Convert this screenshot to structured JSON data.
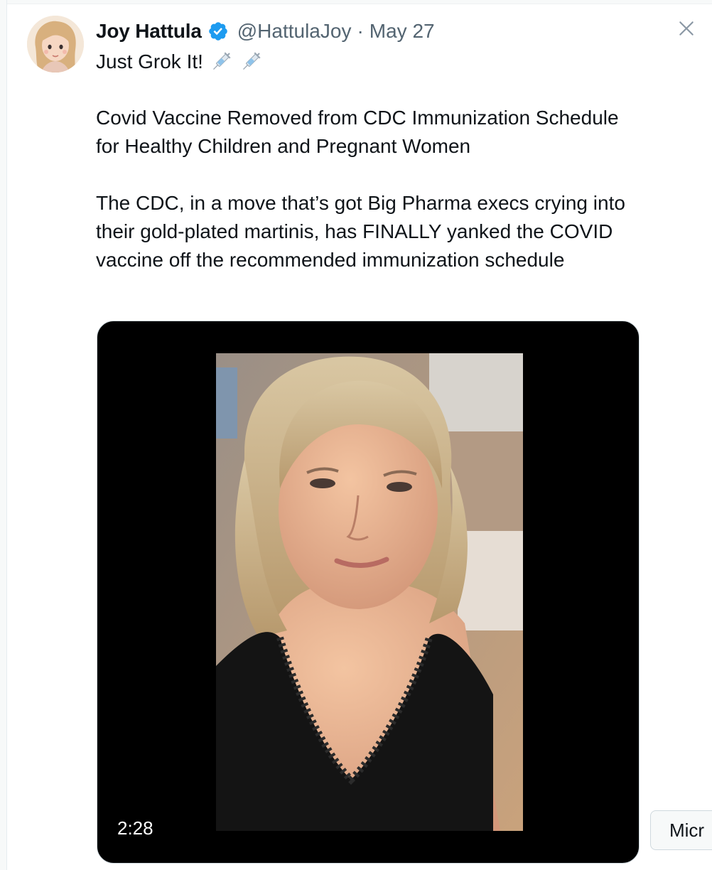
{
  "author": {
    "display_name": "Joy Hattula",
    "handle": "@HattulaJoy",
    "separator": "·",
    "date": "May 27",
    "verified_color": "#1d9bf0"
  },
  "tweet": {
    "line1": "Just Grok It!",
    "line1_emoji": [
      "syringe-icon",
      "syringe-icon"
    ],
    "headline": "Covid Vaccine Removed from CDC Immunization Schedule for Healthy Children and Pregnant Women",
    "body": "The CDC, in a move that’s got Big Pharma execs crying into their gold-plated martinis, has FINALLY yanked the COVID vaccine off the recommended immunization schedule"
  },
  "video": {
    "duration": "2:28"
  },
  "side_button": {
    "label": "Micr"
  },
  "colors": {
    "text_primary": "#0f1419",
    "text_secondary": "#536471",
    "accent": "#1d9bf0"
  }
}
